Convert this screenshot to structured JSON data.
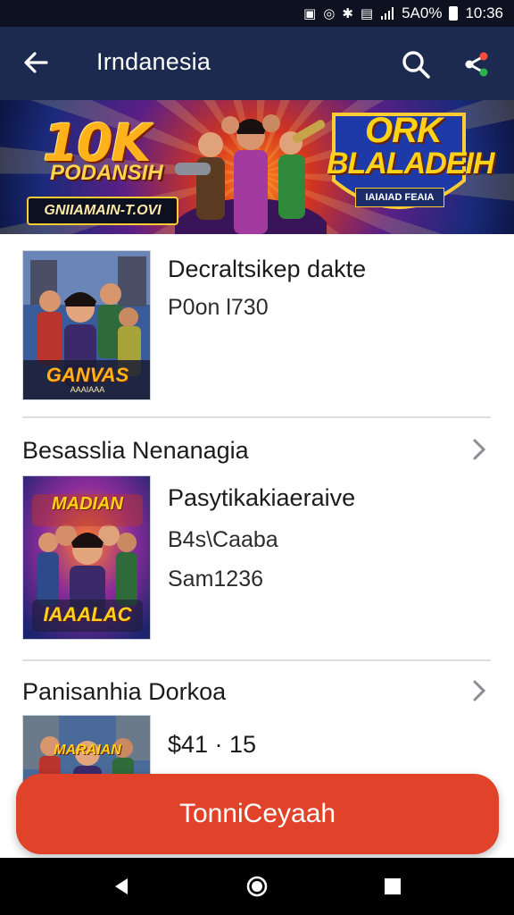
{
  "status_bar": {
    "network_text": "5A0%",
    "time": "10:36",
    "icons": [
      "sim-icon",
      "notification-icon",
      "bluetooth-icon",
      "vibrate-icon",
      "signal-icon",
      "battery-icon"
    ]
  },
  "app_bar": {
    "title": "Irndanesia",
    "icons": [
      "back-arrow-icon",
      "search-icon",
      "share-icon"
    ]
  },
  "banner": {
    "left_title": "10K",
    "left_subtitle": "PODANSIH",
    "left_tag": "GNIIAMAIN-T.OVI",
    "right_title": "ORK",
    "right_subtitle": "BLALADEIH",
    "right_tag": "IAIAIAD FEAIA",
    "colors": {
      "accent": "#ffb21c",
      "deep": "#1a2a7a"
    }
  },
  "items": [
    {
      "title": "Decraltsikep dakte",
      "lines": [
        "P0on l730"
      ],
      "thumb_label": "GANVAS",
      "thumb_sublabel": "AAAIAAA"
    }
  ],
  "sections": [
    {
      "title": "Besasslia Nenanagia",
      "items": [
        {
          "title": "Pasytikakiaeraive",
          "lines": [
            "B4s\\Caaba",
            "Sam1236"
          ],
          "thumb_label_top": "MADIAN",
          "thumb_label_bottom": "IAAALAC"
        }
      ]
    },
    {
      "title": "Panisanhia Dorkoa",
      "items": [
        {
          "title": "$41 · 15",
          "lines": [],
          "thumb_label_top": "MARAIAN"
        }
      ]
    }
  ],
  "cta": {
    "label": "TonniCeyaah",
    "color": "#e0432a"
  },
  "nav_bar": {
    "icons": [
      "back-triangle-icon",
      "home-circle-icon",
      "recents-square-icon"
    ]
  },
  "colors": {
    "app_bar": "#1b2a4e",
    "status_bar": "#0e1220"
  }
}
